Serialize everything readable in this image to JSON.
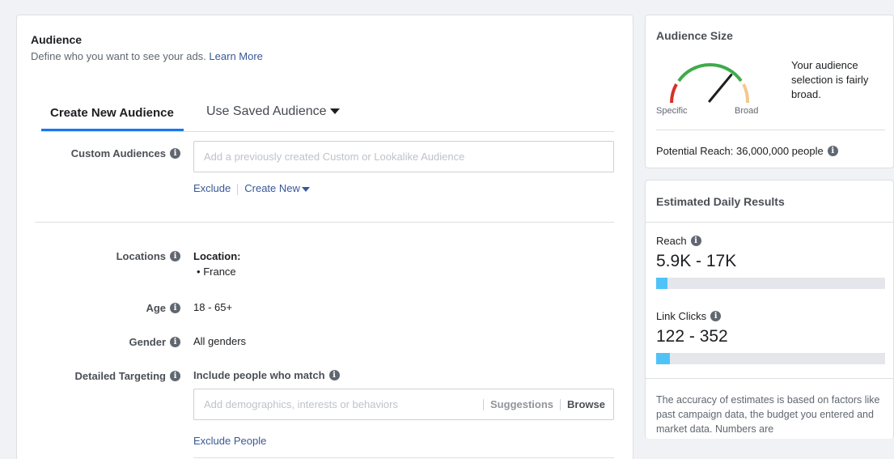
{
  "audience": {
    "title": "Audience",
    "description": "Define who you want to see your ads.",
    "learn_more": "Learn More",
    "tabs": [
      {
        "label": "Create New Audience"
      },
      {
        "label": "Use Saved Audience"
      }
    ],
    "custom_audiences": {
      "label": "Custom Audiences",
      "placeholder": "Add a previously created Custom or Lookalike Audience",
      "exclude": "Exclude",
      "create_new": "Create New"
    },
    "locations": {
      "label": "Locations",
      "heading": "Location:",
      "items": [
        "France"
      ]
    },
    "age": {
      "label": "Age",
      "value": "18 - 65+"
    },
    "gender": {
      "label": "Gender",
      "value": "All genders"
    },
    "detailed_targeting": {
      "label": "Detailed Targeting",
      "include_label": "Include people who match",
      "placeholder": "Add demographics, interests or behaviors",
      "suggestions": "Suggestions",
      "browse": "Browse",
      "exclude_people": "Exclude People"
    }
  },
  "audience_size": {
    "title": "Audience Size",
    "gauge_specific": "Specific",
    "gauge_broad": "Broad",
    "gauge_level": 0.72,
    "message": "Your audience selection is fairly broad.",
    "potential_reach": "Potential Reach: 36,000,000 people"
  },
  "estimated": {
    "title": "Estimated Daily Results",
    "reach_label": "Reach",
    "reach_value": "5.9K - 17K",
    "reach_fill": 0.05,
    "clicks_label": "Link Clicks",
    "clicks_value": "122 - 352",
    "clicks_fill": 0.06,
    "footnote": "The accuracy of estimates is based on factors like past campaign data, the budget you entered and market data. Numbers are"
  },
  "colors": {
    "link": "#385898",
    "tab_active": "#1877f2",
    "bar_fill": "#4fc3f7",
    "gauge_green": "#3eab4a",
    "gauge_red": "#d93025",
    "gauge_tan": "#f3c88c"
  }
}
